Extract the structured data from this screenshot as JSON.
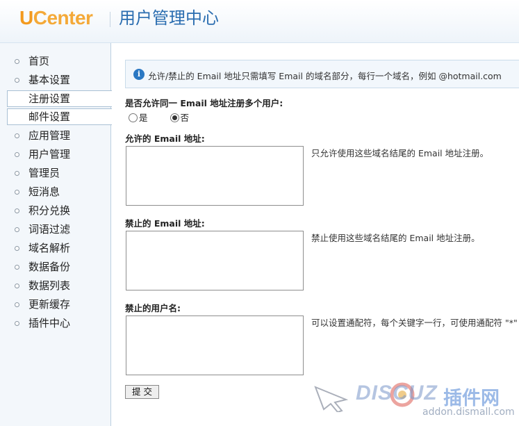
{
  "header": {
    "logo_u": "U",
    "logo_rest": "Center",
    "title": "用户管理中心"
  },
  "sidebar": {
    "items": [
      {
        "label": "首页",
        "active": false
      },
      {
        "label": "基本设置",
        "active": false
      },
      {
        "label": "注册设置",
        "active": true
      },
      {
        "label": "邮件设置",
        "active": true
      },
      {
        "label": "应用管理",
        "active": false
      },
      {
        "label": "用户管理",
        "active": false
      },
      {
        "label": "管理员",
        "active": false
      },
      {
        "label": "短消息",
        "active": false
      },
      {
        "label": "积分兑换",
        "active": false
      },
      {
        "label": "词语过滤",
        "active": false
      },
      {
        "label": "域名解析",
        "active": false
      },
      {
        "label": "数据备份",
        "active": false
      },
      {
        "label": "数据列表",
        "active": false
      },
      {
        "label": "更新缓存",
        "active": false
      },
      {
        "label": "插件中心",
        "active": false
      }
    ]
  },
  "main": {
    "tip": "允许/禁止的 Email 地址只需填写 Email 的域名部分，每行一个域名，例如 @hotmail.com",
    "multi_email": {
      "label": "是否允许同一 Email 地址注册多个用户:",
      "yes": "是",
      "no": "否",
      "selected": "no"
    },
    "allowed_email": {
      "label": "允许的 Email 地址:",
      "value": "",
      "help": "只允许使用这些域名结尾的 Email 地址注册。"
    },
    "banned_email": {
      "label": "禁止的 Email 地址:",
      "value": "",
      "help": "禁止使用这些域名结尾的 Email 地址注册。"
    },
    "banned_username": {
      "label": "禁止的用户名:",
      "value": "",
      "help": "可以设置通配符，每个关键字一行，可使用通配符 \"*\" 如"
    },
    "submit_label": "提交"
  },
  "watermark": {
    "brand": "DISCUZ",
    "cn": "插件网",
    "url": "addon.dismall.com"
  }
}
